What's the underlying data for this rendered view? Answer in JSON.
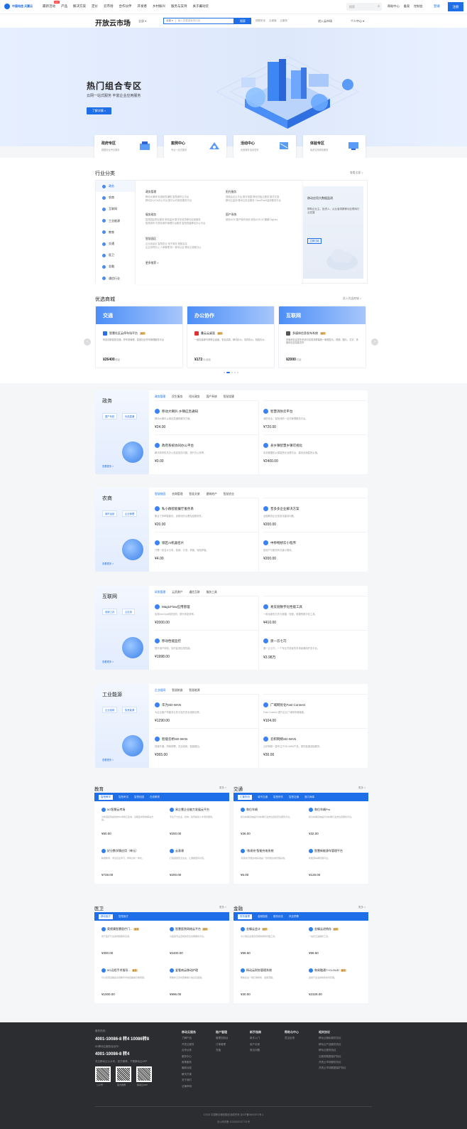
{
  "topnav": {
    "logo_text": "中国电信 天翼云",
    "items": [
      "最新活动",
      "产品",
      "解决方案",
      "定价",
      "云市场",
      "合作伙伴",
      "开发者",
      "乡村振兴",
      "服务与支持",
      "关于翼动云"
    ],
    "hot_badge": "HOT",
    "search_placeholder": "搜索",
    "links": [
      "帮助中心",
      "备案",
      "控制台"
    ],
    "login": "登录",
    "register": "注册"
  },
  "bar2": {
    "brand": "开放云市场",
    "location": "全部 ▾",
    "search_category": "全部 ▾",
    "search_placeholder": "输入您要搜索的内容",
    "search_button": "搜索",
    "hot_keywords": [
      "视频安全",
      "云桌面",
      "云服务"
    ],
    "join": "进入云市场",
    "me": "个人中心 ▾"
  },
  "hero": {
    "title": "热门组合专区",
    "subtitle": "云网一站式服务 丰富企业应用服务",
    "button": "了解详情 >"
  },
  "quick_cards": [
    {
      "title": "政府专区",
      "desc": "数据安全专业服务"
    },
    {
      "title": "案例中心",
      "desc": "专业一站式服务"
    },
    {
      "title": "活动中心",
      "desc": "优惠服务活动发布"
    },
    {
      "title": "体验专区",
      "desc": "免费试用体验服务"
    }
  ],
  "industry": {
    "title": "行业分类",
    "more": "查看全部 >",
    "sidebar": [
      "政务",
      "农商",
      "互联网",
      "工业能源",
      "教育",
      "交通",
      "医卫",
      "金融",
      "通信行业"
    ],
    "groups": [
      {
        "title": "政务管理",
        "lines": [
          "移动大律师  街道政务通知  智慧城市云平台",
          "移动办公OA办公平台  数字乡村政务服务平台"
        ]
      },
      {
        "title": "阳光服务",
        "lines": [
          "视频会议云平台  数字校园  移动白板云服务  数字文旅",
          "移动云监测  移动云安全服务  CloudPaaS监测服务平台"
        ]
      },
      {
        "title": "服务政务",
        "lines": [
          "智慧园区物业服务  舆情监测  数字化政务移动应用服务",
          "智慧城市  可视化城市管理中台服务  智慧党建移动办公平台"
        ]
      },
      {
        "title": "国产系统",
        "lines": [
          "统信UOS  国产操作系统  统信UOS-20 麒麟 Digi'ers"
        ]
      },
      {
        "title": "智慧园区",
        "lines": [
          "企业信息化  智慧农业  电子政务 视频会议",
          "企业协同办公  人事管理  统一身份认证  移动云视频办公"
        ]
      }
    ],
    "more_link": "更多推荐 >",
    "promo": {
      "title": "移动应用大数据监测",
      "desc": "帮助企业主、投资人、从业者洞察移动互联网行业发展",
      "button": "立即订阅"
    }
  },
  "preferred": {
    "title": "优选商城",
    "more": "进入优选商城 >",
    "cards": [
      {
        "banner": "交通",
        "name": "智慧社区云停车场平台",
        "tag": "推荐",
        "desc": "科技创新智慧交通，停车场管理，智慧社区停车管理服务平台",
        "price": "¥26400",
        "unit": "/套起"
      },
      {
        "banner": "办公协作",
        "name": "叠云云桌面",
        "tag": "推荐",
        "desc": "一键安装即可获得云桌面，安全高效、移动办公、协同办公，轻松办公",
        "price": "¥172",
        "unit": "/月/桌面"
      },
      {
        "banner": "互联网",
        "name": "多媒体信息发布系统",
        "tag": "推荐",
        "desc": "多媒体信息发布系统可实现多屏幕统一管理显示，视频、图片、文字、多媒体信息智能发布",
        "price": "¥2000",
        "unit": "/次起"
      }
    ]
  },
  "categories": [
    {
      "title": "政务",
      "tags": [
        "国产系统",
        "优选直通"
      ],
      "view_more": "查看更多 >",
      "tabs": [
        "政务管理",
        "民生服务",
        "阳光政务",
        "国产系统",
        "智慧党建"
      ],
      "items": [
        {
          "name": "移动大喇叭-乡镇应急通知",
          "tag": "",
          "desc": "移动大喇叭乡镇应急通知解决方案。",
          "price": "¥24.00"
        },
        {
          "name": "智慧消防云平台",
          "tag": "",
          "desc": "消防安全、智慧消防一站式管理服务平台。",
          "price": "¥720.00"
        },
        {
          "name": "政府系统协同办公平台",
          "tag": "",
          "desc": "解决政府机关办公信息孤岛问题，提升办公效率。",
          "price": "¥0.00"
        },
        {
          "name": "县乡镇智慧乡镇可视化",
          "tag": "",
          "desc": "实用便捷的乡镇智慧化治理平台，建设全面智慧乡镇。",
          "price": "¥2400.00"
        }
      ]
    },
    {
      "title": "农商",
      "tags": [
        "城市运营",
        "企业管理"
      ],
      "view_more": "查看更多 >",
      "tabs": [
        "智慧校园",
        "农商管理",
        "智慧文旅",
        "建筑地产",
        "智慧农业"
      ],
      "items": [
        {
          "name": "私小群智能餐厅服务系",
          "tag": "",
          "desc": "集合了多种智能化，自助化的点餐及结账软件。",
          "price": "¥20.00"
        },
        {
          "name": "普多多企业解决方案",
          "tag": "",
          "desc": "全面解决企业信息化建设问题。",
          "price": "¥200.00"
        },
        {
          "name": "锁匠AI机器名片",
          "tag": "",
          "desc": "只需一张名片分享，营销、引流、获客，轻松获客。",
          "price": "¥4.00"
        },
        {
          "name": "中移畅想云小程序",
          "tag": "",
          "desc": "如用户与服务商共建小程序。",
          "price": "¥200.00"
        }
      ]
    },
    {
      "title": "互联网",
      "tags": [
        "营销工具",
        "云应用"
      ],
      "view_more": "查看更多 >",
      "tabs": [
        "研发管理",
        "云资源产",
        "通信互联",
        "服务工具"
      ],
      "items": [
        {
          "name": "MagicFlow应用管理",
          "tag": "",
          "desc": "实现DevOps研发协同，提升研发效率。",
          "price": "¥2000.00"
        },
        {
          "name": "易支链数字化性能工具",
          "tag": "",
          "desc": "一种全新的方式与便捷、快速，便捷的数字化工具。",
          "price": "¥410.00"
        },
        {
          "name": "移动性能监控",
          "tag": "",
          "desc": "提升用户体验，实时监测应用性能。",
          "price": "¥1998.00"
        },
        {
          "name": "渡一云七巧",
          "tag": "",
          "desc": "渡一云七巧，一个专业开发者的多场景通用开发平台。",
          "price": "¥3.98万"
        }
      ]
    },
    {
      "title": "工业能源",
      "tags": [
        "企业组网",
        "智慧能源"
      ],
      "view_more": "查看更多 >",
      "tabs": [
        "企业组网",
        "智慧制造",
        "智慧能源"
      ],
      "items": [
        {
          "name": "华为SD-WAN",
          "tag": "",
          "desc": "为企业客户构建多云多分支的安全组网互联。",
          "price": "¥1290.00"
        },
        {
          "name": "广域网优化Fast Connect",
          "tag": "",
          "desc": "Fast-Connect 提升企业广域网传输速度。",
          "price": "¥104.00"
        },
        {
          "name": "智能云桥SD-WAN",
          "tag": "",
          "desc": "快速开通，简单部署，灵活组网，智能路由。",
          "price": "¥365.00"
        },
        {
          "name": "云织网络SD-WAN",
          "tag": "",
          "desc": "云织网络一直专注于SD-WAN产品，提供极速连接服务。",
          "price": "¥30.00"
        }
      ]
    }
  ],
  "grids": [
    {
      "title": "教育",
      "more": "更多 >",
      "tabs": [
        "智慧教学",
        "智慧考试",
        "智慧校园",
        "在线教育"
      ],
      "items": [
        {
          "name": "5G智慧云考场",
          "tag": "",
          "desc": "为新冠疫情提供的5G考场云监考，远程监考整体解决方案。",
          "price": "¥60.00"
        },
        {
          "name": "易企慧企业能力发展云平台",
          "tag": "",
          "desc": "专注于为企业，机构，政府提供人才培养服务。",
          "price": "¥200.00"
        },
        {
          "name": "好分数学情应用（单元）",
          "tag": "",
          "desc": "精准教学，学生自主学习，学情分析一体化。",
          "price": "¥728.00"
        },
        {
          "name": "云表课",
          "tag": "",
          "desc": "打造健康安全生态，让课堂更有价值。",
          "price": "¥200.00"
        }
      ]
    },
    {
      "title": "交通",
      "more": "更多 >",
      "tabs": [
        "汇集物流",
        "城市交通",
        "智慧停车",
        "智慧交通",
        "港口海事"
      ],
      "items": [
        {
          "name": "和位车辆",
          "tag": "",
          "desc": "和位车辆系统是针对车辆行业的位置和定位服务平台。",
          "price": "¥36.00"
        },
        {
          "name": "和位车辆Pro",
          "tag": "",
          "desc": "和位车辆系统是针对车辆行业的位置服务平台。",
          "price": "¥32.00"
        },
        {
          "name": "“和易充”智能充电系统",
          "tag": "",
          "desc": "“和易充”智能充电系统是一款智能充电管理系统。",
          "price": "¥5.00"
        },
        {
          "name": "智慧新能源车管理平台",
          "tag": "",
          "desc": "新能源车辆管理平台。",
          "price": "¥128.00"
        }
      ]
    },
    {
      "title": "医卫",
      "more": "更多 >",
      "tabs": [
        "移动医疗",
        "智慧医疗"
      ],
      "items": [
        {
          "name": "奥视康智慧医疗门...",
          "tag": "推荐",
          "desc": "用于医疗行业的视频服务应用。",
          "price": "¥300.00"
        },
        {
          "name": "智慧医院网络云平台",
          "tag": "推荐",
          "desc": "为医院专业定制的安全内网服务平台。",
          "price": "¥2400.00"
        },
        {
          "name": "5G远程手术指导...",
          "tag": "推荐",
          "desc": "可以实现远程会诊观看手术的直播或示教视频。",
          "price": "¥1000.00"
        },
        {
          "name": "爱看病云移动护理",
          "tag": "",
          "desc": "帮助护士实时查看病人信息及医嘱。",
          "price": "¥996.00"
        }
      ]
    },
    {
      "title": "金融",
      "more": "更多 >",
      "tabs": [
        "财务管理",
        "金融智能",
        "服务优化",
        "风控预警"
      ],
      "items": [
        {
          "name": "金蝶云会计",
          "tag": "推荐",
          "desc": "为小微企业量身定制的财务管理工具。",
          "price": "¥99.60"
        },
        {
          "name": "金蝶云进销存",
          "tag": "推荐",
          "desc": "一站式云进销存工具。",
          "price": "¥99.60"
        },
        {
          "name": "杨动云财务管理系统",
          "tag": "",
          "desc": "帮助企业一键打通财务、发票流程。",
          "price": "¥30.00"
        },
        {
          "name": "和易融通T+CLOUD",
          "tag": "推荐",
          "desc": "适用于企业的财务协同管理。",
          "price": "¥2328.00"
        }
      ]
    }
  ],
  "footer": {
    "hotline_label": "服务热线：",
    "hotline1": "4001-10086-8 转4 10086转8",
    "hotline2_label": "5G移动云服务及合作：",
    "hotline2": "4001-10086-8 转4",
    "follow_label": "关注移动云公众号、官方微博，下载移动云APP",
    "qr_labels": [
      "公众号",
      "官方微博",
      "移动云APP"
    ],
    "columns": [
      {
        "h": "移动云服务",
        "items": [
          "了解产品",
          "开发云服务",
          "合作伙伴",
          "服务中心",
          "政策服务",
          "最新动态",
          "解决方案",
          "关于我们",
          "法律声明"
        ]
      },
      {
        "h": "账户管理",
        "items": [
          "管理控制台",
          "订单管理",
          "充值"
        ]
      },
      {
        "h": "新手指南",
        "items": [
          "新手入门",
          "用户手册",
          "常见问题"
        ]
      },
      {
        "h": "帮助与中心",
        "items": [
          "意见反馈"
        ]
      },
      {
        "h": "相关协议",
        "items": [
          "移动云隐私服务协议",
          "移动云产品服务协议",
          "移动云服务协议",
          "云服务数据保护协议",
          "开放云市场服务协议",
          "开放云市场数据保护协议"
        ]
      }
    ],
    "copyright": "©2023 中国移动通信集团 版权所有  京ICP备05002571号-1",
    "beian": "京公网安备 11010802027721号"
  }
}
